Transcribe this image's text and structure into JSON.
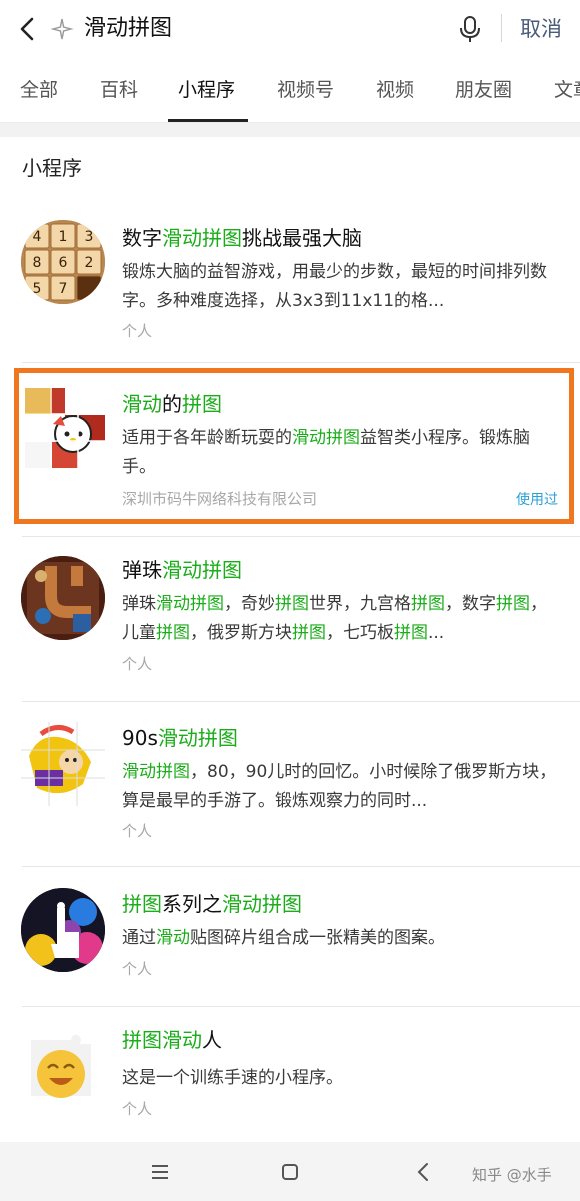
{
  "search": {
    "query": "滑动拼图",
    "cancel_label": "取消"
  },
  "tabs": [
    {
      "label": "全部"
    },
    {
      "label": "百科"
    },
    {
      "label": "小程序"
    },
    {
      "label": "视频号"
    },
    {
      "label": "视频"
    },
    {
      "label": "朋友圈"
    },
    {
      "label": "文章"
    }
  ],
  "active_tab": "小程序",
  "section_title": "小程序",
  "results": [
    {
      "title": [
        {
          "t": "数字"
        },
        {
          "t": "滑动拼图",
          "hl": true
        },
        {
          "t": "挑战最强大脑"
        }
      ],
      "desc": [
        {
          "t": "锻炼大脑的益智游戏，用最少的步数，最短的时间排列数字。多种难度选择，从3x3到11x11的格..."
        }
      ],
      "meta": "个人",
      "used": "",
      "thumb_tiles": [
        "4",
        "1",
        "3",
        "8",
        "6",
        "2",
        "5",
        "7",
        ""
      ]
    },
    {
      "title": [
        {
          "t": "滑动",
          "hl": true
        },
        {
          "t": "的"
        },
        {
          "t": "拼图",
          "hl": true
        }
      ],
      "desc": [
        {
          "t": "适用于各年龄断玩耍的"
        },
        {
          "t": "滑动拼图",
          "hl": true
        },
        {
          "t": "益智类小程序。锻炼脑手。"
        }
      ],
      "meta": "深圳市码牛网络科技有限公司",
      "used": "使用过"
    },
    {
      "title": [
        {
          "t": "弹珠"
        },
        {
          "t": "滑动拼图",
          "hl": true
        }
      ],
      "desc": [
        {
          "t": "弹珠"
        },
        {
          "t": "滑动拼图",
          "hl": true
        },
        {
          "t": "，奇妙"
        },
        {
          "t": "拼图",
          "hl": true
        },
        {
          "t": "世界，九宫格"
        },
        {
          "t": "拼图",
          "hl": true
        },
        {
          "t": "，数字"
        },
        {
          "t": "拼图",
          "hl": true
        },
        {
          "t": "，儿童"
        },
        {
          "t": "拼图",
          "hl": true
        },
        {
          "t": "，俄罗斯方块"
        },
        {
          "t": "拼图",
          "hl": true
        },
        {
          "t": "，七巧板"
        },
        {
          "t": "拼图",
          "hl": true
        },
        {
          "t": "..."
        }
      ],
      "meta": "个人",
      "used": ""
    },
    {
      "title": [
        {
          "t": "90s"
        },
        {
          "t": "滑动拼图",
          "hl": true
        }
      ],
      "desc": [
        {
          "t": "滑动拼图",
          "hl": true
        },
        {
          "t": "，80，90儿时的回忆。小时候除了俄罗斯方块，算是最早的手游了。锻炼观察力的同时..."
        }
      ],
      "meta": "个人",
      "used": ""
    },
    {
      "title": [
        {
          "t": "拼图",
          "hl": true
        },
        {
          "t": "系列之"
        },
        {
          "t": "滑动拼图",
          "hl": true
        }
      ],
      "desc": [
        {
          "t": "通过"
        },
        {
          "t": "滑动",
          "hl": true
        },
        {
          "t": "贴图碎片组合成一张精美的图案。"
        }
      ],
      "meta": "个人",
      "used": ""
    },
    {
      "title": [
        {
          "t": "拼图滑动",
          "hl": true
        },
        {
          "t": "人"
        }
      ],
      "desc": [
        {
          "t": "这是一个训练手速的小程序。"
        }
      ],
      "meta": "个人",
      "used": ""
    }
  ],
  "watermark": "知乎 @水手",
  "colors": {
    "highlight_green": "#1aad19",
    "selection_box": "#f07620",
    "used_blue": "#2aa0d8"
  },
  "icons": [
    "back-arrow-icon",
    "sparkle-icon",
    "microphone-icon",
    "menu-icon",
    "home-square-icon",
    "back-triangle-icon"
  ]
}
